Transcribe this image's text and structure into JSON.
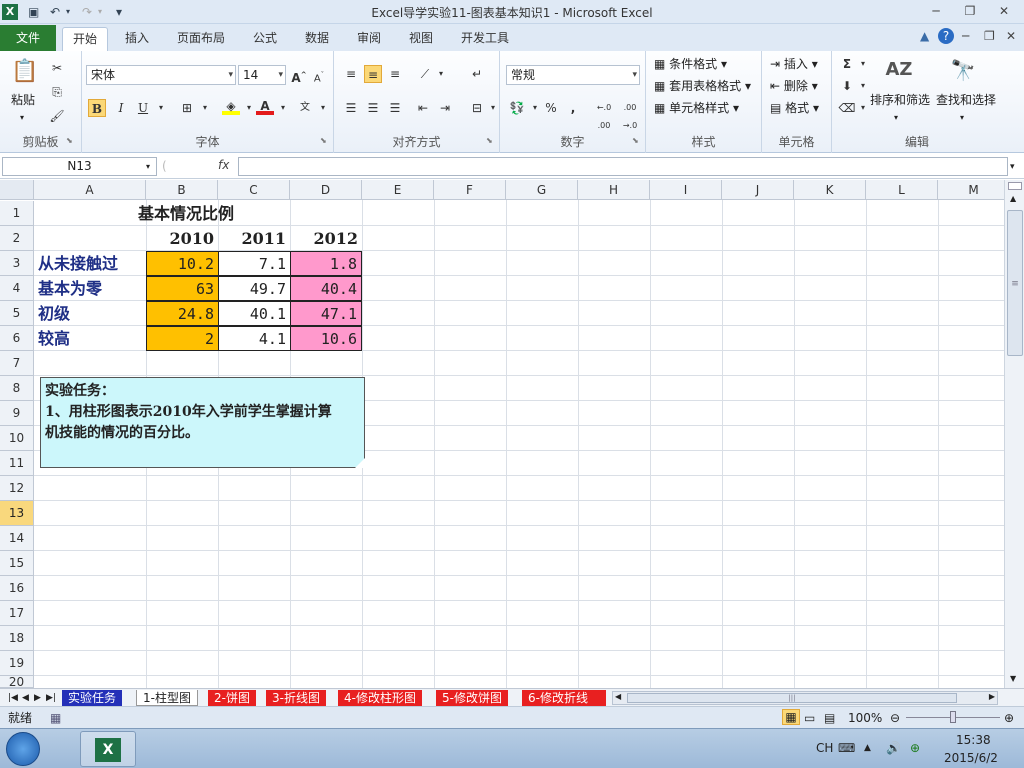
{
  "window": {
    "title": "Excel导学实验11-图表基本知识1 - Microsoft Excel"
  },
  "tabs": [
    "文件",
    "开始",
    "插入",
    "页面布局",
    "公式",
    "数据",
    "审阅",
    "视图",
    "开发工具"
  ],
  "ribbon": {
    "clipboard": {
      "label": "剪贴板",
      "paste": "粘贴"
    },
    "font": {
      "label": "字体",
      "name": "宋体",
      "size": "14",
      "bold": "B",
      "italic": "I",
      "underline": "U"
    },
    "alignment": {
      "label": "对齐方式"
    },
    "number": {
      "label": "数字",
      "format": "常规",
      "percent": "%",
      "comma": ",",
      "inc": "←.0 .00",
      "dec": ".00 →.0"
    },
    "styles": {
      "label": "样式",
      "cond": "条件格式",
      "table": "套用表格格式",
      "cell": "单元格样式"
    },
    "cells": {
      "label": "单元格",
      "insert": "插入",
      "delete": "删除",
      "format": "格式"
    },
    "editing": {
      "label": "编辑",
      "sigma": "Σ",
      "sort": "排序和筛选",
      "find": "查找和选择"
    }
  },
  "formula_bar": {
    "name_box": "N13",
    "fx": "fx",
    "formula": ""
  },
  "columns": [
    "A",
    "B",
    "C",
    "D",
    "E",
    "F",
    "G",
    "H",
    "I",
    "J",
    "K",
    "L",
    "M"
  ],
  "rows": [
    "1",
    "2",
    "3",
    "4",
    "5",
    "6",
    "7",
    "8",
    "9",
    "10",
    "11",
    "12",
    "13",
    "14",
    "15",
    "16",
    "17",
    "18",
    "19",
    "20"
  ],
  "sheet": {
    "title": "基本情况比例",
    "years": [
      "2010",
      "2011",
      "2012"
    ],
    "data": [
      {
        "label": "从未接触过",
        "values": [
          "10.2",
          "7.1",
          "1.8"
        ]
      },
      {
        "label": "基本为零",
        "values": [
          "63",
          "49.7",
          "40.4"
        ]
      },
      {
        "label": "初级",
        "values": [
          "24.8",
          "40.1",
          "47.1"
        ]
      },
      {
        "label": "较高",
        "values": [
          "2",
          "4.1",
          "10.6"
        ]
      }
    ],
    "note_lines": [
      "实验任务：",
      "1、用柱形图表示2010年入学前学生掌握计算",
      "机技能的情况的百分比。"
    ]
  },
  "sheet_tabs": [
    "实验任务",
    "1-柱型图",
    "2-饼图",
    "3-折线图",
    "4-修改柱形图",
    "5-修改饼图",
    "6-修改折线"
  ],
  "status": {
    "mode": "就绪",
    "zoom": "100%"
  },
  "taskbar": {
    "lang": "CH",
    "time": "15:38",
    "date": "2015/6/2"
  },
  "colors": {
    "col_b": "#ffc000",
    "col_d": "#ff99cc",
    "note_bg": "#ccf7fb",
    "label_text": "#1f2f86",
    "file_tab": "#2a7d32"
  }
}
